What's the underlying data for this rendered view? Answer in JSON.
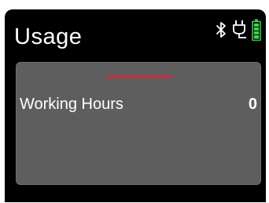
{
  "header": {
    "title": "Usage",
    "icons": [
      "bluetooth-icon",
      "plug-icon",
      "battery-icon"
    ]
  },
  "card": {
    "label": "Working Hours",
    "value": "0"
  },
  "colors": {
    "screen_background": "#000000",
    "card_background": "#5e5e5e",
    "accent": "#d12b3c",
    "battery": "#3ccf4e",
    "text": "#ffffff"
  }
}
